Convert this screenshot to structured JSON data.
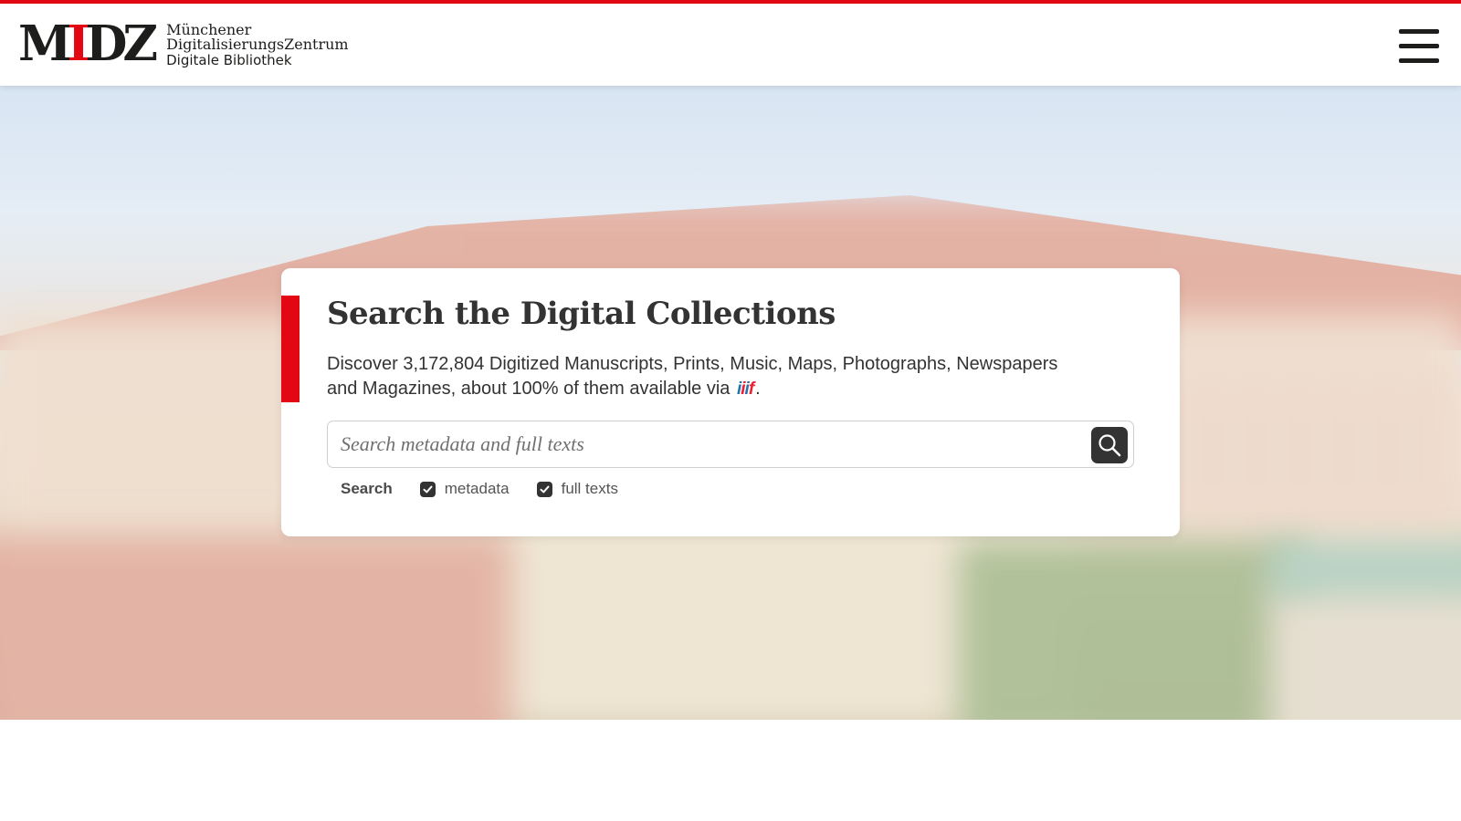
{
  "header": {
    "logo": {
      "mark": "MDZ",
      "line1": "Münchener",
      "line2": "DigitalisierungsZentrum",
      "line3": "Digitale Bibliothek"
    },
    "menu_icon": "hamburger-menu-icon"
  },
  "hero": {
    "background": "blurred photo of library building"
  },
  "search_card": {
    "title": "Search the Digital Collections",
    "description_before": "Discover 3,172,804 Digitized Manuscripts, Prints, Music, Maps, Photographs, Newspapers and Magazines, about 100% of them available via",
    "iiif_label": "iiif",
    "description_after": ".",
    "search_placeholder": "Search metadata and full texts",
    "search_value": "",
    "search_button_icon": "search-icon",
    "options_label": "Search",
    "options": [
      {
        "label": "metadata",
        "checked": true
      },
      {
        "label": "full texts",
        "checked": true
      }
    ]
  },
  "colors": {
    "accent": "#e30613",
    "text": "#333333",
    "button": "#333333"
  }
}
